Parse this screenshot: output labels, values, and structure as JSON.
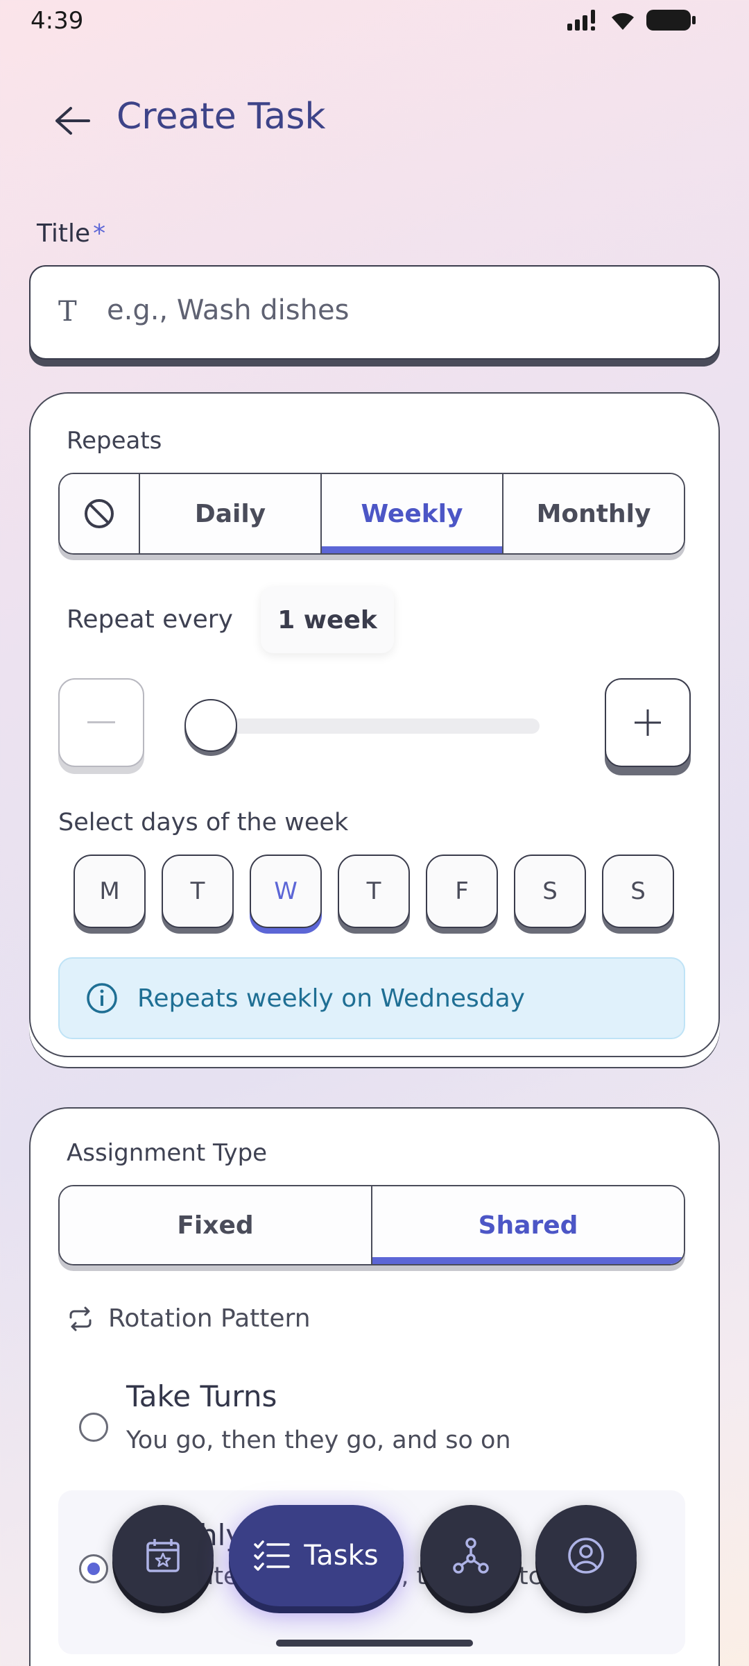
{
  "status": {
    "time": "4:39"
  },
  "header": {
    "title": "Create Task"
  },
  "title_field": {
    "label": "Title",
    "required_mark": "*",
    "placeholder": "e.g., Wash dishes",
    "value": ""
  },
  "repeats": {
    "label": "Repeats",
    "options": [
      {
        "label": "",
        "icon": "no-repeat-icon",
        "active": false
      },
      {
        "label": "Daily",
        "active": false
      },
      {
        "label": "Weekly",
        "active": true
      },
      {
        "label": "Monthly",
        "active": false
      }
    ],
    "repeat_every_label": "Repeat every",
    "repeat_every_value": "1 week",
    "interval_level": 0,
    "days_label": "Select days of the week",
    "days": [
      {
        "label": "M",
        "active": false
      },
      {
        "label": "T",
        "active": false
      },
      {
        "label": "W",
        "active": true
      },
      {
        "label": "T",
        "active": false
      },
      {
        "label": "F",
        "active": false
      },
      {
        "label": "S",
        "active": false
      },
      {
        "label": "S",
        "active": false
      }
    ],
    "summary": "Repeats weekly on Wednesday"
  },
  "assignment": {
    "label": "Assignment Type",
    "options": [
      {
        "label": "Fixed",
        "active": false
      },
      {
        "label": "Shared",
        "active": true
      }
    ],
    "rotation_label": "Rotation Pattern",
    "patterns": [
      {
        "title": "Take Turns",
        "desc": "You go, then they go, and so on",
        "checked": false
      },
      {
        "title": "Monthly",
        "desc": "Alternate every month, then switch",
        "checked": true
      }
    ]
  },
  "nav": {
    "items": [
      {
        "icon": "calendar-star-icon"
      },
      {
        "icon": "tasks-list-icon",
        "label": "Tasks",
        "active": true
      },
      {
        "icon": "network-icon"
      },
      {
        "icon": "profile-icon"
      }
    ]
  },
  "colors": {
    "accent": "#5c66d6",
    "title": "#3d4388",
    "info_bg": "#e0f1fb",
    "info_text": "#1f6f94"
  }
}
